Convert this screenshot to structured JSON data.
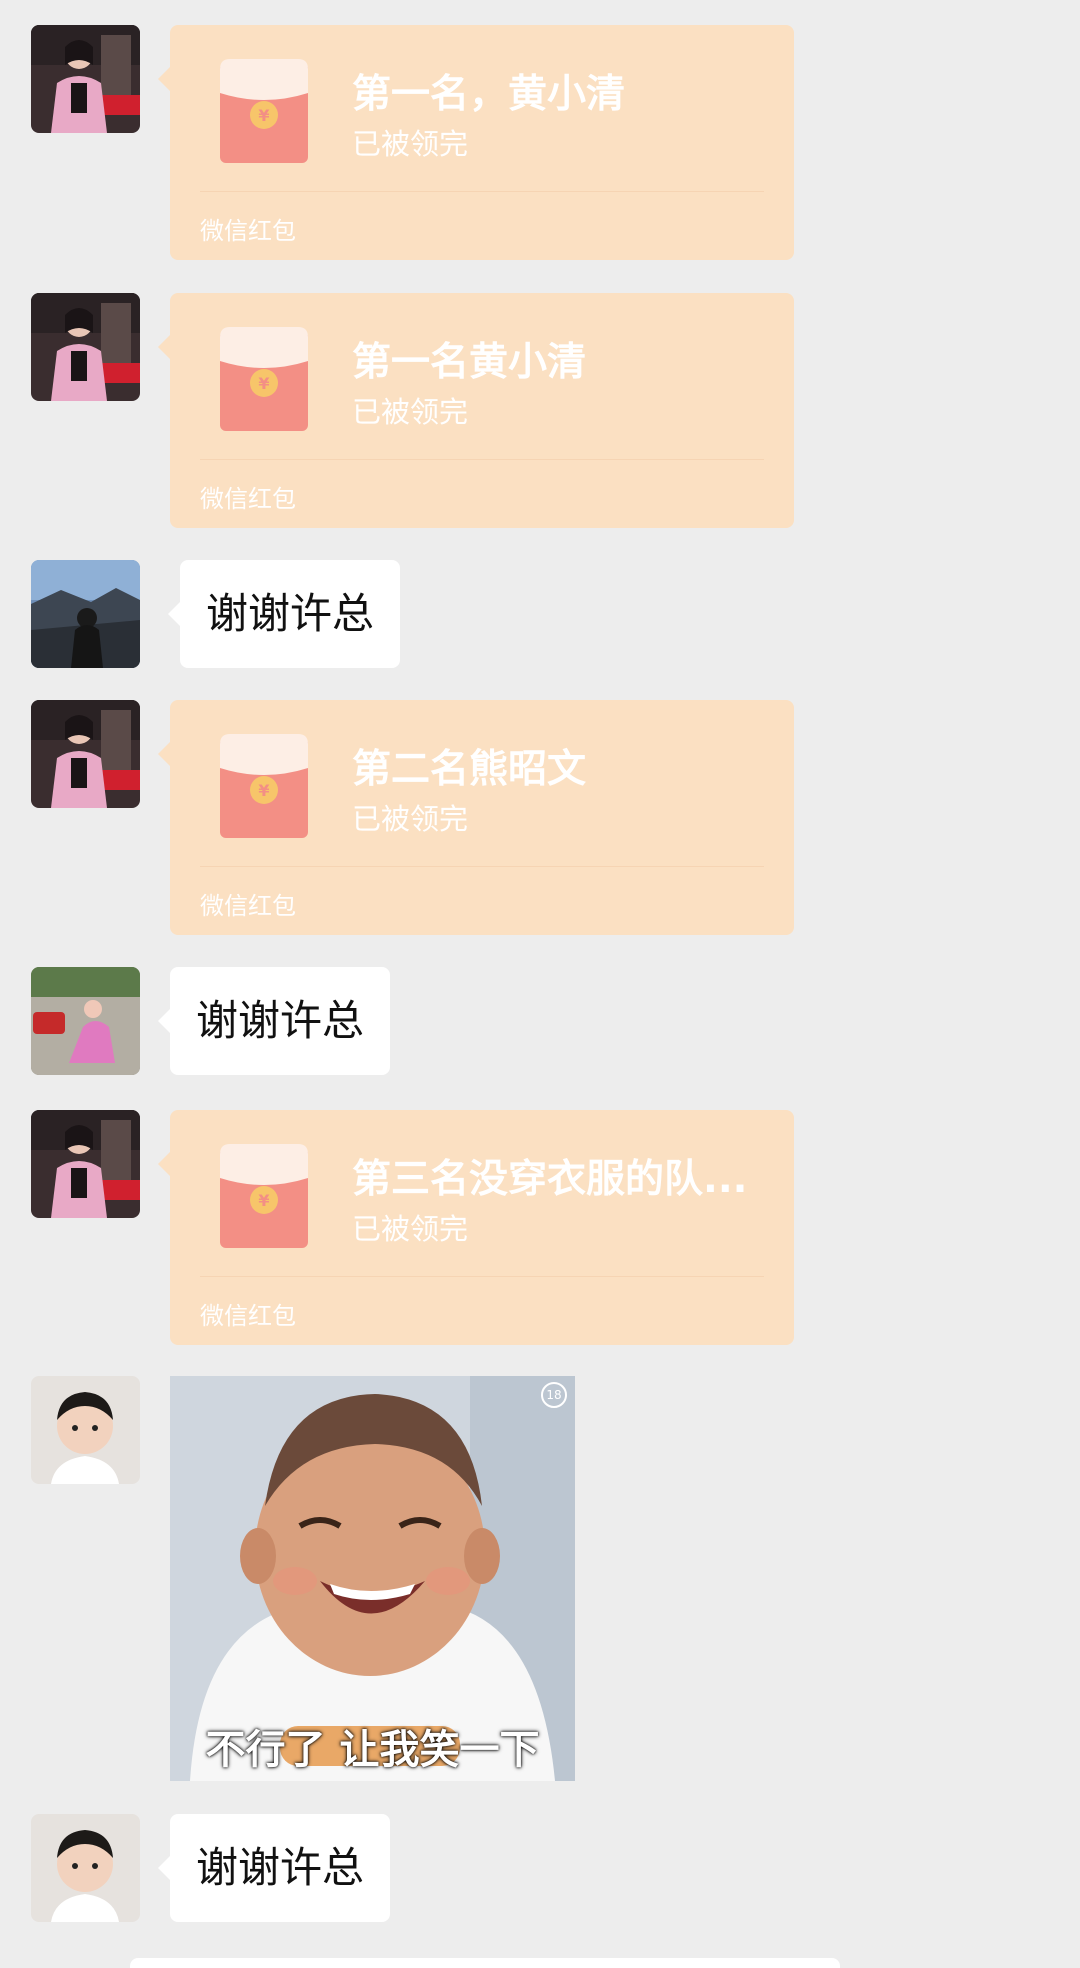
{
  "messages": [
    {
      "type": "red_packet",
      "title": "第一名，黄小清",
      "status": "已被领完",
      "brand": "微信红包"
    },
    {
      "type": "red_packet",
      "title": "第一名黄小清",
      "status": "已被领完",
      "brand": "微信红包"
    },
    {
      "type": "text",
      "text": "谢谢许总"
    },
    {
      "type": "red_packet",
      "title": "第二名熊昭文",
      "status": "已被领完",
      "brand": "微信红包"
    },
    {
      "type": "text",
      "text": "谢谢许总"
    },
    {
      "type": "red_packet",
      "title": "第三名没穿衣服的队...",
      "status": "已被领完",
      "brand": "微信红包"
    },
    {
      "type": "sticker",
      "caption": "不行了 让我笑一下",
      "badge": "18"
    },
    {
      "type": "text",
      "text": "谢谢许总"
    }
  ],
  "colors": {
    "background": "#ededed",
    "red_packet_bg": "#fbe0c2",
    "envelope_red": "#f38f85",
    "envelope_flap": "#fdeee5",
    "coin": "#f7c56a"
  }
}
